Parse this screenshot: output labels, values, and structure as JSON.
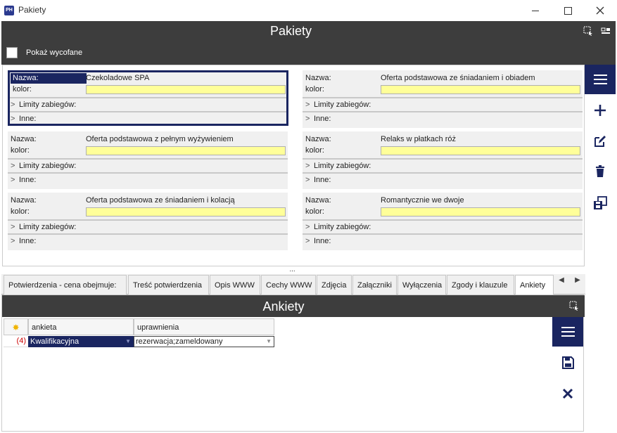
{
  "window": {
    "title": "Pakiety",
    "app_icon_text": "PH"
  },
  "header": {
    "title": "Pakiety",
    "show_retired_label": "Pokaż wycofane"
  },
  "cards": [
    {
      "name_label": "Nazwa:",
      "name": "Czekoladowe SPA",
      "color_label": "kolor:",
      "limits_label": "Limity zabiegów:",
      "other_label": "Inne:",
      "selected": true
    },
    {
      "name_label": "Nazwa:",
      "name": "Oferta podstawowa ze śniadaniem i obiadem",
      "color_label": "kolor:",
      "limits_label": "Limity zabiegów:",
      "other_label": "Inne:",
      "selected": false
    },
    {
      "name_label": "Nazwa:",
      "name": "Oferta podstawowa z pełnym wyżywieniem",
      "color_label": "kolor:",
      "limits_label": "Limity zabiegów:",
      "other_label": "Inne:",
      "selected": false
    },
    {
      "name_label": "Nazwa:",
      "name": "Relaks w płatkach róż",
      "color_label": "kolor:",
      "limits_label": "Limity zabiegów:",
      "other_label": "Inne:",
      "selected": false
    },
    {
      "name_label": "Nazwa:",
      "name": "Oferta podstawowa ze śniadaniem i kolacją",
      "color_label": "kolor:",
      "limits_label": "Limity zabiegów:",
      "other_label": "Inne:",
      "selected": false
    },
    {
      "name_label": "Nazwa:",
      "name": "Romantycznie we dwoje",
      "color_label": "kolor:",
      "limits_label": "Limity zabiegów:",
      "other_label": "Inne:",
      "selected": false
    }
  ],
  "splitter": "...",
  "tabs": [
    {
      "label": "Potwierdzenia - cena obejmuje:"
    },
    {
      "label": "Treść potwierdzenia"
    },
    {
      "label": "Opis WWW"
    },
    {
      "label": "Cechy WWW"
    },
    {
      "label": "Zdjęcia"
    },
    {
      "label": "Załączniki"
    },
    {
      "label": "Wyłączenia"
    },
    {
      "label": "Zgody i klauzule"
    },
    {
      "label": "Ankiety",
      "active": true
    }
  ],
  "subpanel": {
    "title": "Ankiety",
    "columns": [
      "ankieta",
      "uprawnienia"
    ],
    "rows": [
      {
        "index": "(4)",
        "ankieta": "Kwalifikacyjna",
        "uprawnienia": "rezerwacja;zameldowany"
      }
    ]
  },
  "colors": {
    "accent": "#1a2560",
    "header_bg": "#3d3d3d",
    "color_field": "#ffff99"
  }
}
